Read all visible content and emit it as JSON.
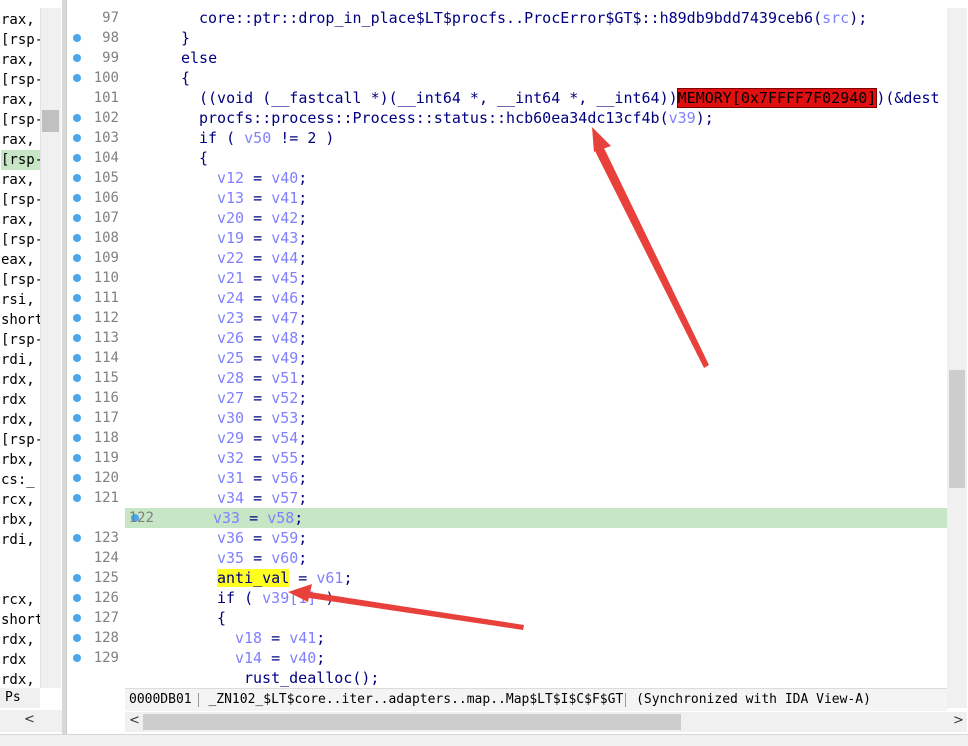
{
  "left_pane": {
    "lines": [
      "rax,",
      "[rsp-",
      "rax,",
      "[rsp-",
      "rax,",
      "[rsp-",
      "rax,",
      "[rsp-",
      "rax,",
      "[rsp-",
      "rax,",
      "[rsp-",
      "eax,",
      "[rsp-",
      "rsi,",
      "short",
      "[rsp-",
      "rdi,",
      "rdx,",
      "rdx",
      "rdx,",
      "[rsp-",
      "rbx,",
      "cs:_",
      "rcx,",
      "rbx,",
      "rdi,",
      "",
      "",
      "rcx,",
      "short",
      "rdx,",
      "rdx",
      "rdx,"
    ],
    "highlighted_index": 7,
    "tab_label": "Ps",
    "scroll_left": "<",
    "scroll_right": ">"
  },
  "code": {
    "lines": [
      {
        "num": "97",
        "dot": false,
        "indent": 8,
        "parts": [
          {
            "t": "core::ptr::drop_in_place$LT$procfs..ProcError$GT$::h89db9bdd7439ceb6("
          },
          {
            "t": "src",
            "c": "var"
          },
          {
            "t": ");"
          }
        ]
      },
      {
        "num": "98",
        "dot": true,
        "indent": 6,
        "parts": [
          {
            "t": "}"
          }
        ]
      },
      {
        "num": "99",
        "dot": true,
        "indent": 6,
        "parts": [
          {
            "t": "else"
          }
        ]
      },
      {
        "num": "100",
        "dot": true,
        "indent": 6,
        "parts": [
          {
            "t": "{"
          }
        ]
      },
      {
        "num": "101",
        "dot": false,
        "indent": 8,
        "parts": [
          {
            "t": "((void (__fastcall *)(__int64 *, __int64 *, __int64))"
          },
          {
            "t": "MEMORY[0x7FFFF7F02940]",
            "c": "mem"
          },
          {
            "t": ")(&dest"
          }
        ]
      },
      {
        "num": "102",
        "dot": true,
        "indent": 8,
        "parts": [
          {
            "t": "procfs::process::Process::status::hcb60ea34dc13cf4b("
          },
          {
            "t": "v39",
            "c": "var"
          },
          {
            "t": ");"
          }
        ]
      },
      {
        "num": "103",
        "dot": true,
        "indent": 8,
        "parts": [
          {
            "t": "if ( "
          },
          {
            "t": "v50",
            "c": "var"
          },
          {
            "t": " != 2 )"
          }
        ]
      },
      {
        "num": "104",
        "dot": true,
        "indent": 8,
        "parts": [
          {
            "t": "{"
          }
        ]
      },
      {
        "num": "105",
        "dot": true,
        "indent": 10,
        "parts": [
          {
            "t": "v12",
            "c": "var"
          },
          {
            "t": " = "
          },
          {
            "t": "v40",
            "c": "var"
          },
          {
            "t": ";"
          }
        ]
      },
      {
        "num": "106",
        "dot": true,
        "indent": 10,
        "parts": [
          {
            "t": "v13",
            "c": "var"
          },
          {
            "t": " = "
          },
          {
            "t": "v41",
            "c": "var"
          },
          {
            "t": ";"
          }
        ]
      },
      {
        "num": "107",
        "dot": true,
        "indent": 10,
        "parts": [
          {
            "t": "v20",
            "c": "var"
          },
          {
            "t": " = "
          },
          {
            "t": "v42",
            "c": "var"
          },
          {
            "t": ";"
          }
        ]
      },
      {
        "num": "108",
        "dot": true,
        "indent": 10,
        "parts": [
          {
            "t": "v19",
            "c": "var"
          },
          {
            "t": " = "
          },
          {
            "t": "v43",
            "c": "var"
          },
          {
            "t": ";"
          }
        ]
      },
      {
        "num": "109",
        "dot": true,
        "indent": 10,
        "parts": [
          {
            "t": "v22",
            "c": "var"
          },
          {
            "t": " = "
          },
          {
            "t": "v44",
            "c": "var"
          },
          {
            "t": ";"
          }
        ]
      },
      {
        "num": "110",
        "dot": true,
        "indent": 10,
        "parts": [
          {
            "t": "v21",
            "c": "var"
          },
          {
            "t": " = "
          },
          {
            "t": "v45",
            "c": "var"
          },
          {
            "t": ";"
          }
        ]
      },
      {
        "num": "111",
        "dot": true,
        "indent": 10,
        "parts": [
          {
            "t": "v24",
            "c": "var"
          },
          {
            "t": " = "
          },
          {
            "t": "v46",
            "c": "var"
          },
          {
            "t": ";"
          }
        ]
      },
      {
        "num": "112",
        "dot": true,
        "indent": 10,
        "parts": [
          {
            "t": "v23",
            "c": "var"
          },
          {
            "t": " = "
          },
          {
            "t": "v47",
            "c": "var"
          },
          {
            "t": ";"
          }
        ]
      },
      {
        "num": "113",
        "dot": true,
        "indent": 10,
        "parts": [
          {
            "t": "v26",
            "c": "var"
          },
          {
            "t": " = "
          },
          {
            "t": "v48",
            "c": "var"
          },
          {
            "t": ";"
          }
        ]
      },
      {
        "num": "114",
        "dot": true,
        "indent": 10,
        "parts": [
          {
            "t": "v25",
            "c": "var"
          },
          {
            "t": " = "
          },
          {
            "t": "v49",
            "c": "var"
          },
          {
            "t": ";"
          }
        ]
      },
      {
        "num": "115",
        "dot": true,
        "indent": 10,
        "parts": [
          {
            "t": "v28",
            "c": "var"
          },
          {
            "t": " = "
          },
          {
            "t": "v51",
            "c": "var"
          },
          {
            "t": ";"
          }
        ]
      },
      {
        "num": "116",
        "dot": true,
        "indent": 10,
        "parts": [
          {
            "t": "v27",
            "c": "var"
          },
          {
            "t": " = "
          },
          {
            "t": "v52",
            "c": "var"
          },
          {
            "t": ";"
          }
        ]
      },
      {
        "num": "117",
        "dot": true,
        "indent": 10,
        "parts": [
          {
            "t": "v30",
            "c": "var"
          },
          {
            "t": " = "
          },
          {
            "t": "v53",
            "c": "var"
          },
          {
            "t": ";"
          }
        ]
      },
      {
        "num": "118",
        "dot": true,
        "indent": 10,
        "parts": [
          {
            "t": "v29",
            "c": "var"
          },
          {
            "t": " = "
          },
          {
            "t": "v54",
            "c": "var"
          },
          {
            "t": ";"
          }
        ]
      },
      {
        "num": "119",
        "dot": true,
        "indent": 10,
        "parts": [
          {
            "t": "v32",
            "c": "var"
          },
          {
            "t": " = "
          },
          {
            "t": "v55",
            "c": "var"
          },
          {
            "t": ";"
          }
        ]
      },
      {
        "num": "120",
        "dot": true,
        "indent": 10,
        "parts": [
          {
            "t": "v31",
            "c": "var"
          },
          {
            "t": " = "
          },
          {
            "t": "v56",
            "c": "var"
          },
          {
            "t": ";"
          }
        ]
      },
      {
        "num": "121",
        "dot": true,
        "indent": 10,
        "parts": [
          {
            "t": "v34",
            "c": "var"
          },
          {
            "t": " = "
          },
          {
            "t": "v57",
            "c": "var"
          },
          {
            "t": ";"
          }
        ]
      },
      {
        "num": "122",
        "dot": true,
        "indent": 10,
        "hl": true,
        "parts": [
          {
            "t": "v33",
            "c": "var"
          },
          {
            "t": " = "
          },
          {
            "t": "v58",
            "c": "var"
          },
          {
            "t": ";"
          }
        ]
      },
      {
        "num": "123",
        "dot": true,
        "indent": 10,
        "parts": [
          {
            "t": "v36",
            "c": "var"
          },
          {
            "t": " = "
          },
          {
            "t": "v59",
            "c": "var"
          },
          {
            "t": ";"
          }
        ]
      },
      {
        "num": "124",
        "dot": false,
        "indent": 10,
        "parts": [
          {
            "t": "v35",
            "c": "var"
          },
          {
            "t": " = "
          },
          {
            "t": "v60",
            "c": "var"
          },
          {
            "t": ";"
          }
        ]
      },
      {
        "num": "125",
        "dot": true,
        "indent": 10,
        "parts": [
          {
            "t": "anti_val",
            "c": "lbl-yellow"
          },
          {
            "t": " = "
          },
          {
            "t": "v61",
            "c": "var"
          },
          {
            "t": ";"
          }
        ]
      },
      {
        "num": "126",
        "dot": true,
        "indent": 10,
        "parts": [
          {
            "t": "if ( "
          },
          {
            "t": "v39[1]",
            "c": "var"
          },
          {
            "t": " )"
          }
        ]
      },
      {
        "num": "127",
        "dot": true,
        "indent": 10,
        "parts": [
          {
            "t": "{"
          }
        ]
      },
      {
        "num": "128",
        "dot": true,
        "indent": 12,
        "parts": [
          {
            "t": "v18",
            "c": "var"
          },
          {
            "t": " = "
          },
          {
            "t": "v41",
            "c": "var"
          },
          {
            "t": ";"
          }
        ]
      },
      {
        "num": "129",
        "dot": true,
        "indent": 12,
        "parts": [
          {
            "t": "v14",
            "c": "var"
          },
          {
            "t": " = "
          },
          {
            "t": "v40",
            "c": "var"
          },
          {
            "t": ";"
          }
        ]
      },
      {
        "num": "",
        "dot": false,
        "indent": 13,
        "parts": [
          {
            "t": "rust_dealloc();"
          }
        ]
      }
    ]
  },
  "status_bar": {
    "address": "0000DB01",
    "function": "_ZN102_$LT$core..iter..adapters..map..Map$LT$I$C$F$GT",
    "sync": "(Synchronized with IDA View-A)"
  },
  "scroll": {
    "left": "<",
    "right": ">"
  },
  "colors": {
    "highlight_line": "#c6e6c6",
    "memory_bg": "#e01010",
    "label_bg": "#ffff20",
    "annotation_arrow": "#e8403a",
    "breakpoint_dot": "#4aa8e8"
  }
}
